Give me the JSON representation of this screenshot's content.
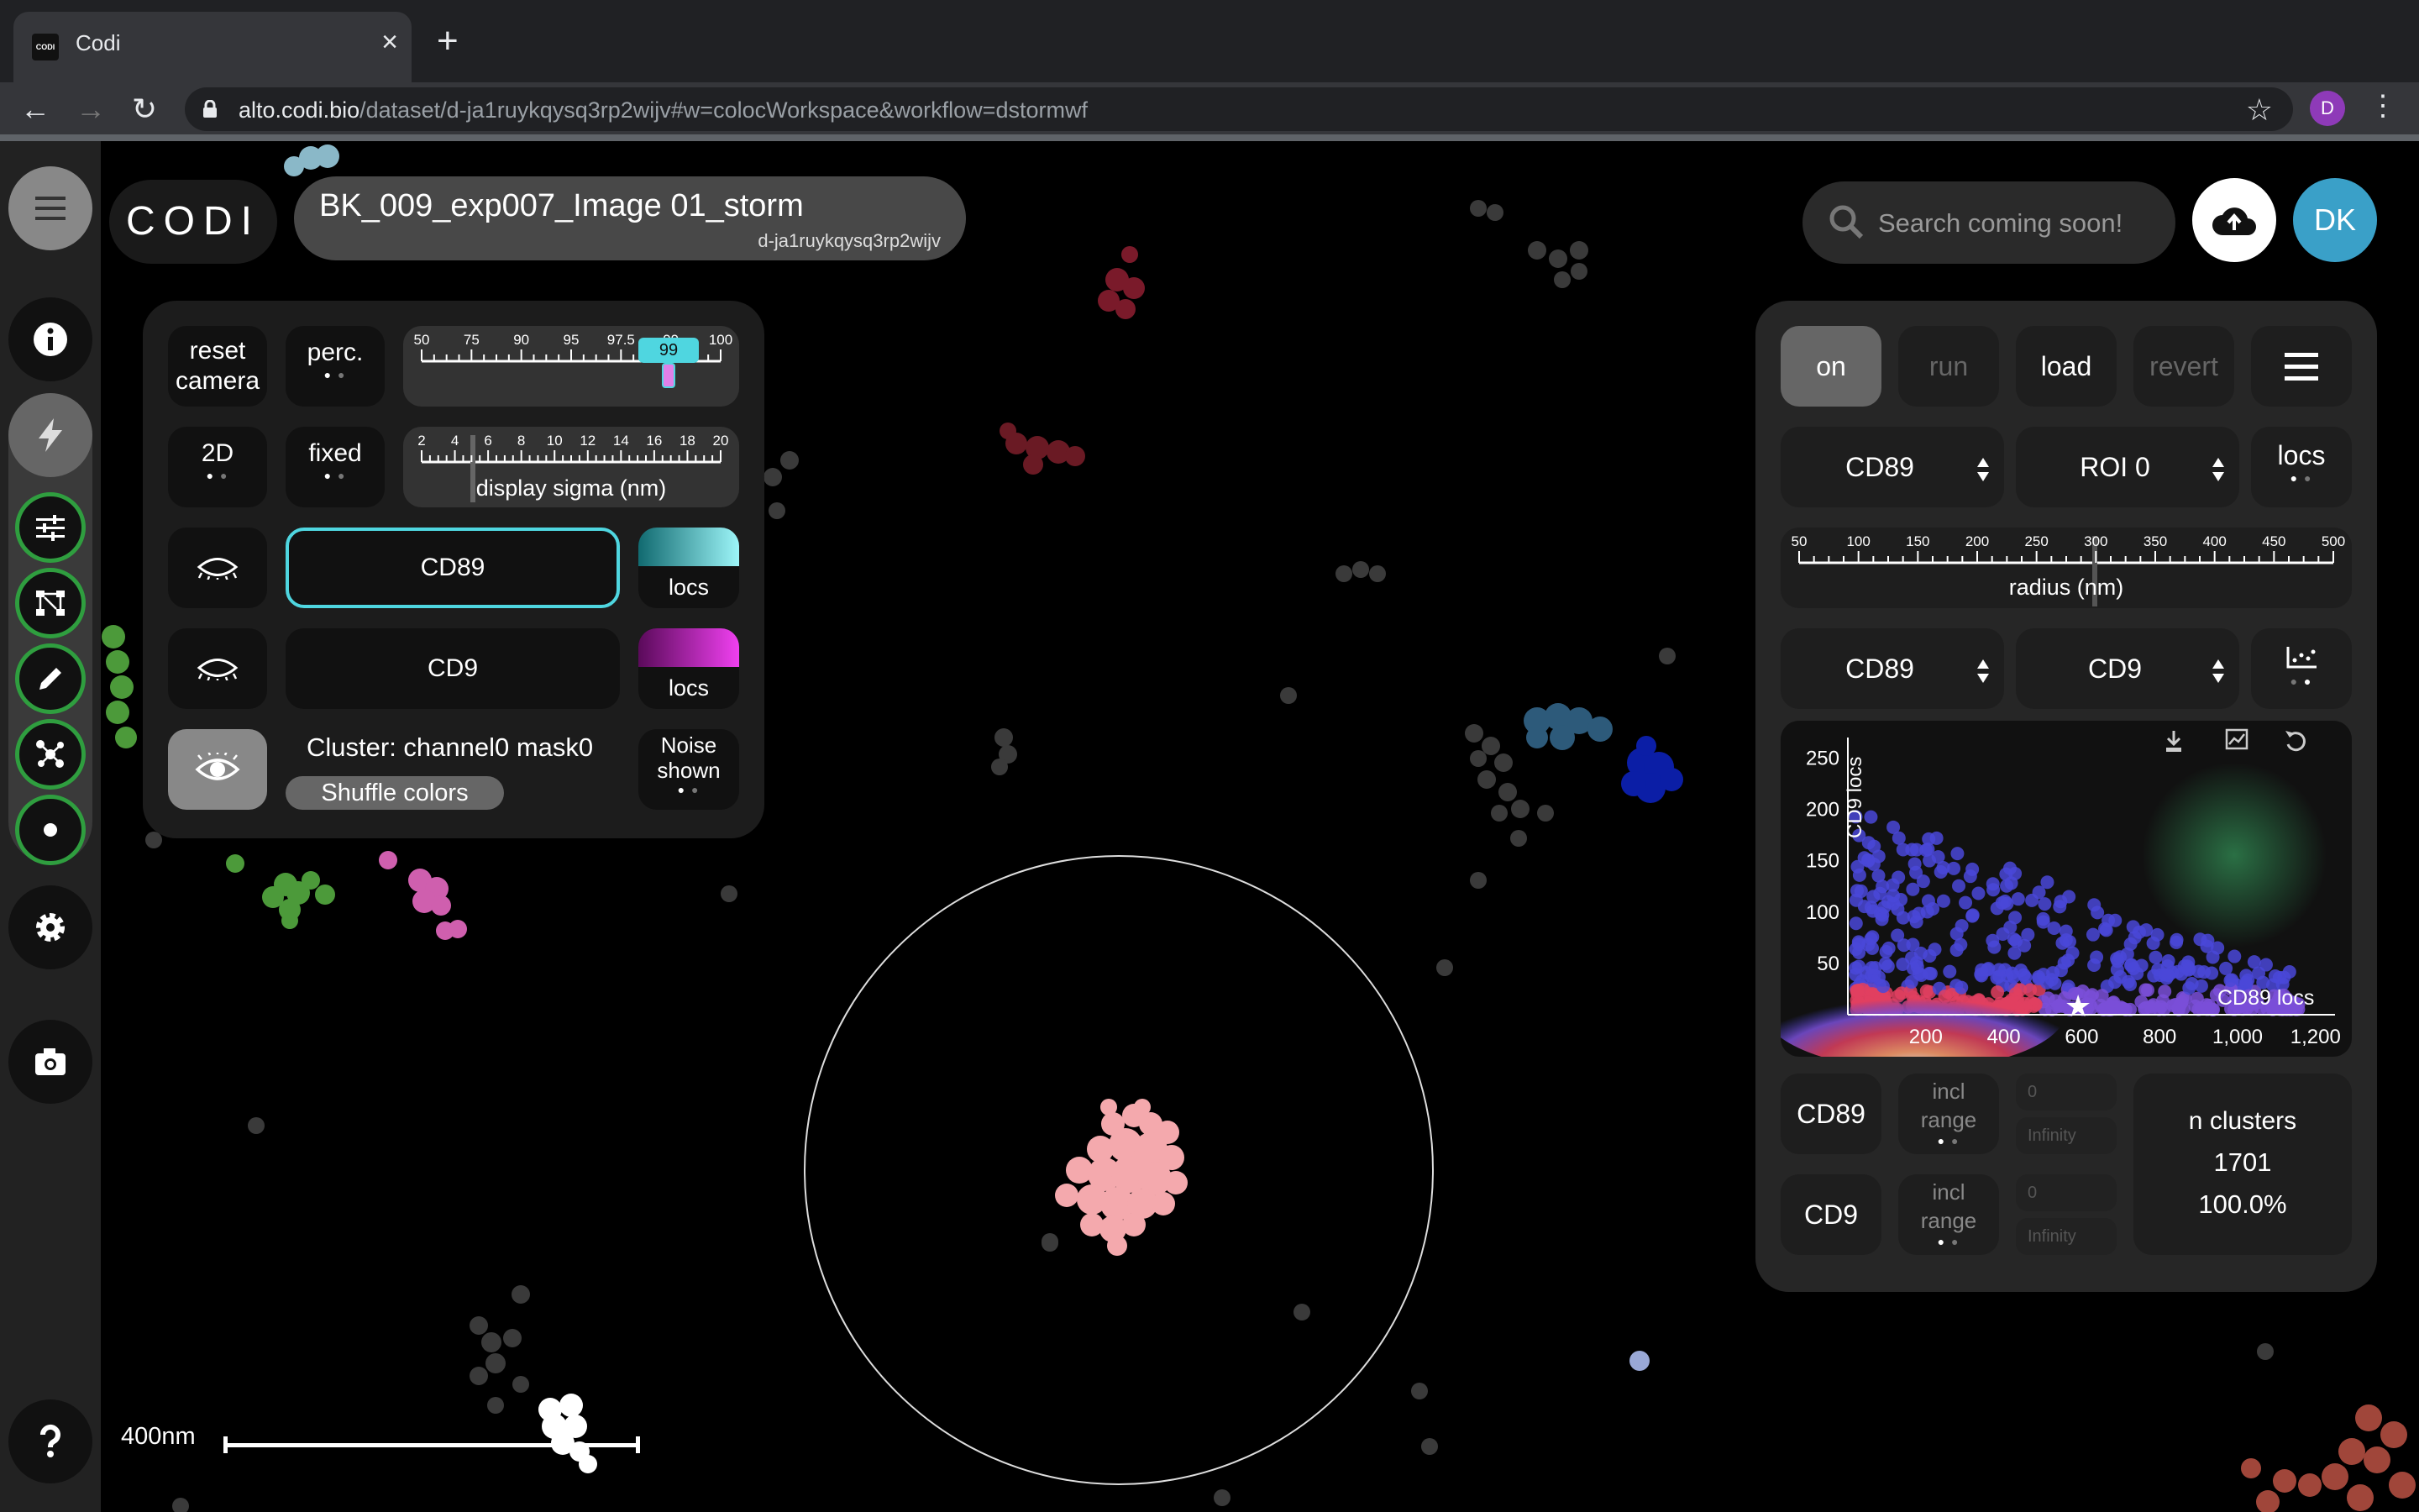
{
  "browser": {
    "tab_title": "Codi",
    "favicon_text": "CODI",
    "url_host": "alto.codi.bio",
    "url_path": "/dataset/d-ja1ruykqysq3rp2wijv#w=colocWorkspace&workflow=dstormwf",
    "profile_initial": "D"
  },
  "header": {
    "logo": "CODI",
    "dataset_title": "BK_009_exp007_Image 01_storm",
    "dataset_id": "d-ja1ruykqysq3rp2wijv",
    "search_placeholder": "Search coming soon!",
    "user_initials": "DK"
  },
  "left_panel": {
    "reset_camera": "reset camera",
    "perc_label": "perc.",
    "percentile_ticks": [
      "50",
      "75",
      "90",
      "95",
      "97.5",
      "99",
      "100"
    ],
    "percentile_value": "99",
    "mode_2d": "2D",
    "fixed_label": "fixed",
    "sigma_ticks": [
      "2",
      "4",
      "6",
      "8",
      "10",
      "12",
      "14",
      "16",
      "18",
      "20"
    ],
    "sigma_label": "display sigma (nm)",
    "channel1": "CD89",
    "channel1_mode": "locs",
    "channel2": "CD9",
    "channel2_mode": "locs",
    "cluster_label": "Cluster: channel0 mask0",
    "shuffle_colors": "Shuffle colors",
    "noise_label": "Noise shown"
  },
  "right_panel": {
    "on": "on",
    "run": "run",
    "load": "load",
    "revert": "revert",
    "channel_select": "CD89",
    "roi_select": "ROI 0",
    "locs_label": "locs",
    "radius_ticks": [
      "50",
      "100",
      "150",
      "200",
      "250",
      "300",
      "350",
      "400",
      "450",
      "500"
    ],
    "radius_label": "radius (nm)",
    "x_channel": "CD89",
    "y_channel": "CD9",
    "filter_ch1": "CD89",
    "filter_ch2": "CD9",
    "incl_range": "incl range",
    "min_value": "0",
    "max_value": "Infinity",
    "n_clusters_label": "n clusters",
    "n_clusters_value": "1701",
    "n_clusters_pct": "100.0%"
  },
  "chart_data": {
    "type": "scatter",
    "xlabel": "CD89 locs",
    "ylabel": "CD9 locs",
    "x_ticks": [
      "200",
      "400",
      "600",
      "800",
      "1,000",
      "1,200"
    ],
    "y_ticks": [
      "50",
      "100",
      "150",
      "200",
      "250"
    ],
    "xlim": [
      0,
      1250
    ],
    "ylim": [
      0,
      270
    ],
    "density_colors": [
      "#4040d0",
      "#7a4fd8",
      "#e04040",
      "#ff9060",
      "#ffffff"
    ]
  },
  "scalebar": {
    "label": "400nm"
  },
  "colors": {
    "accent_cyan": "#4fd6e0",
    "sidebar_green": "#2f9e3f",
    "cluster_pink": "#f4a9ad"
  }
}
